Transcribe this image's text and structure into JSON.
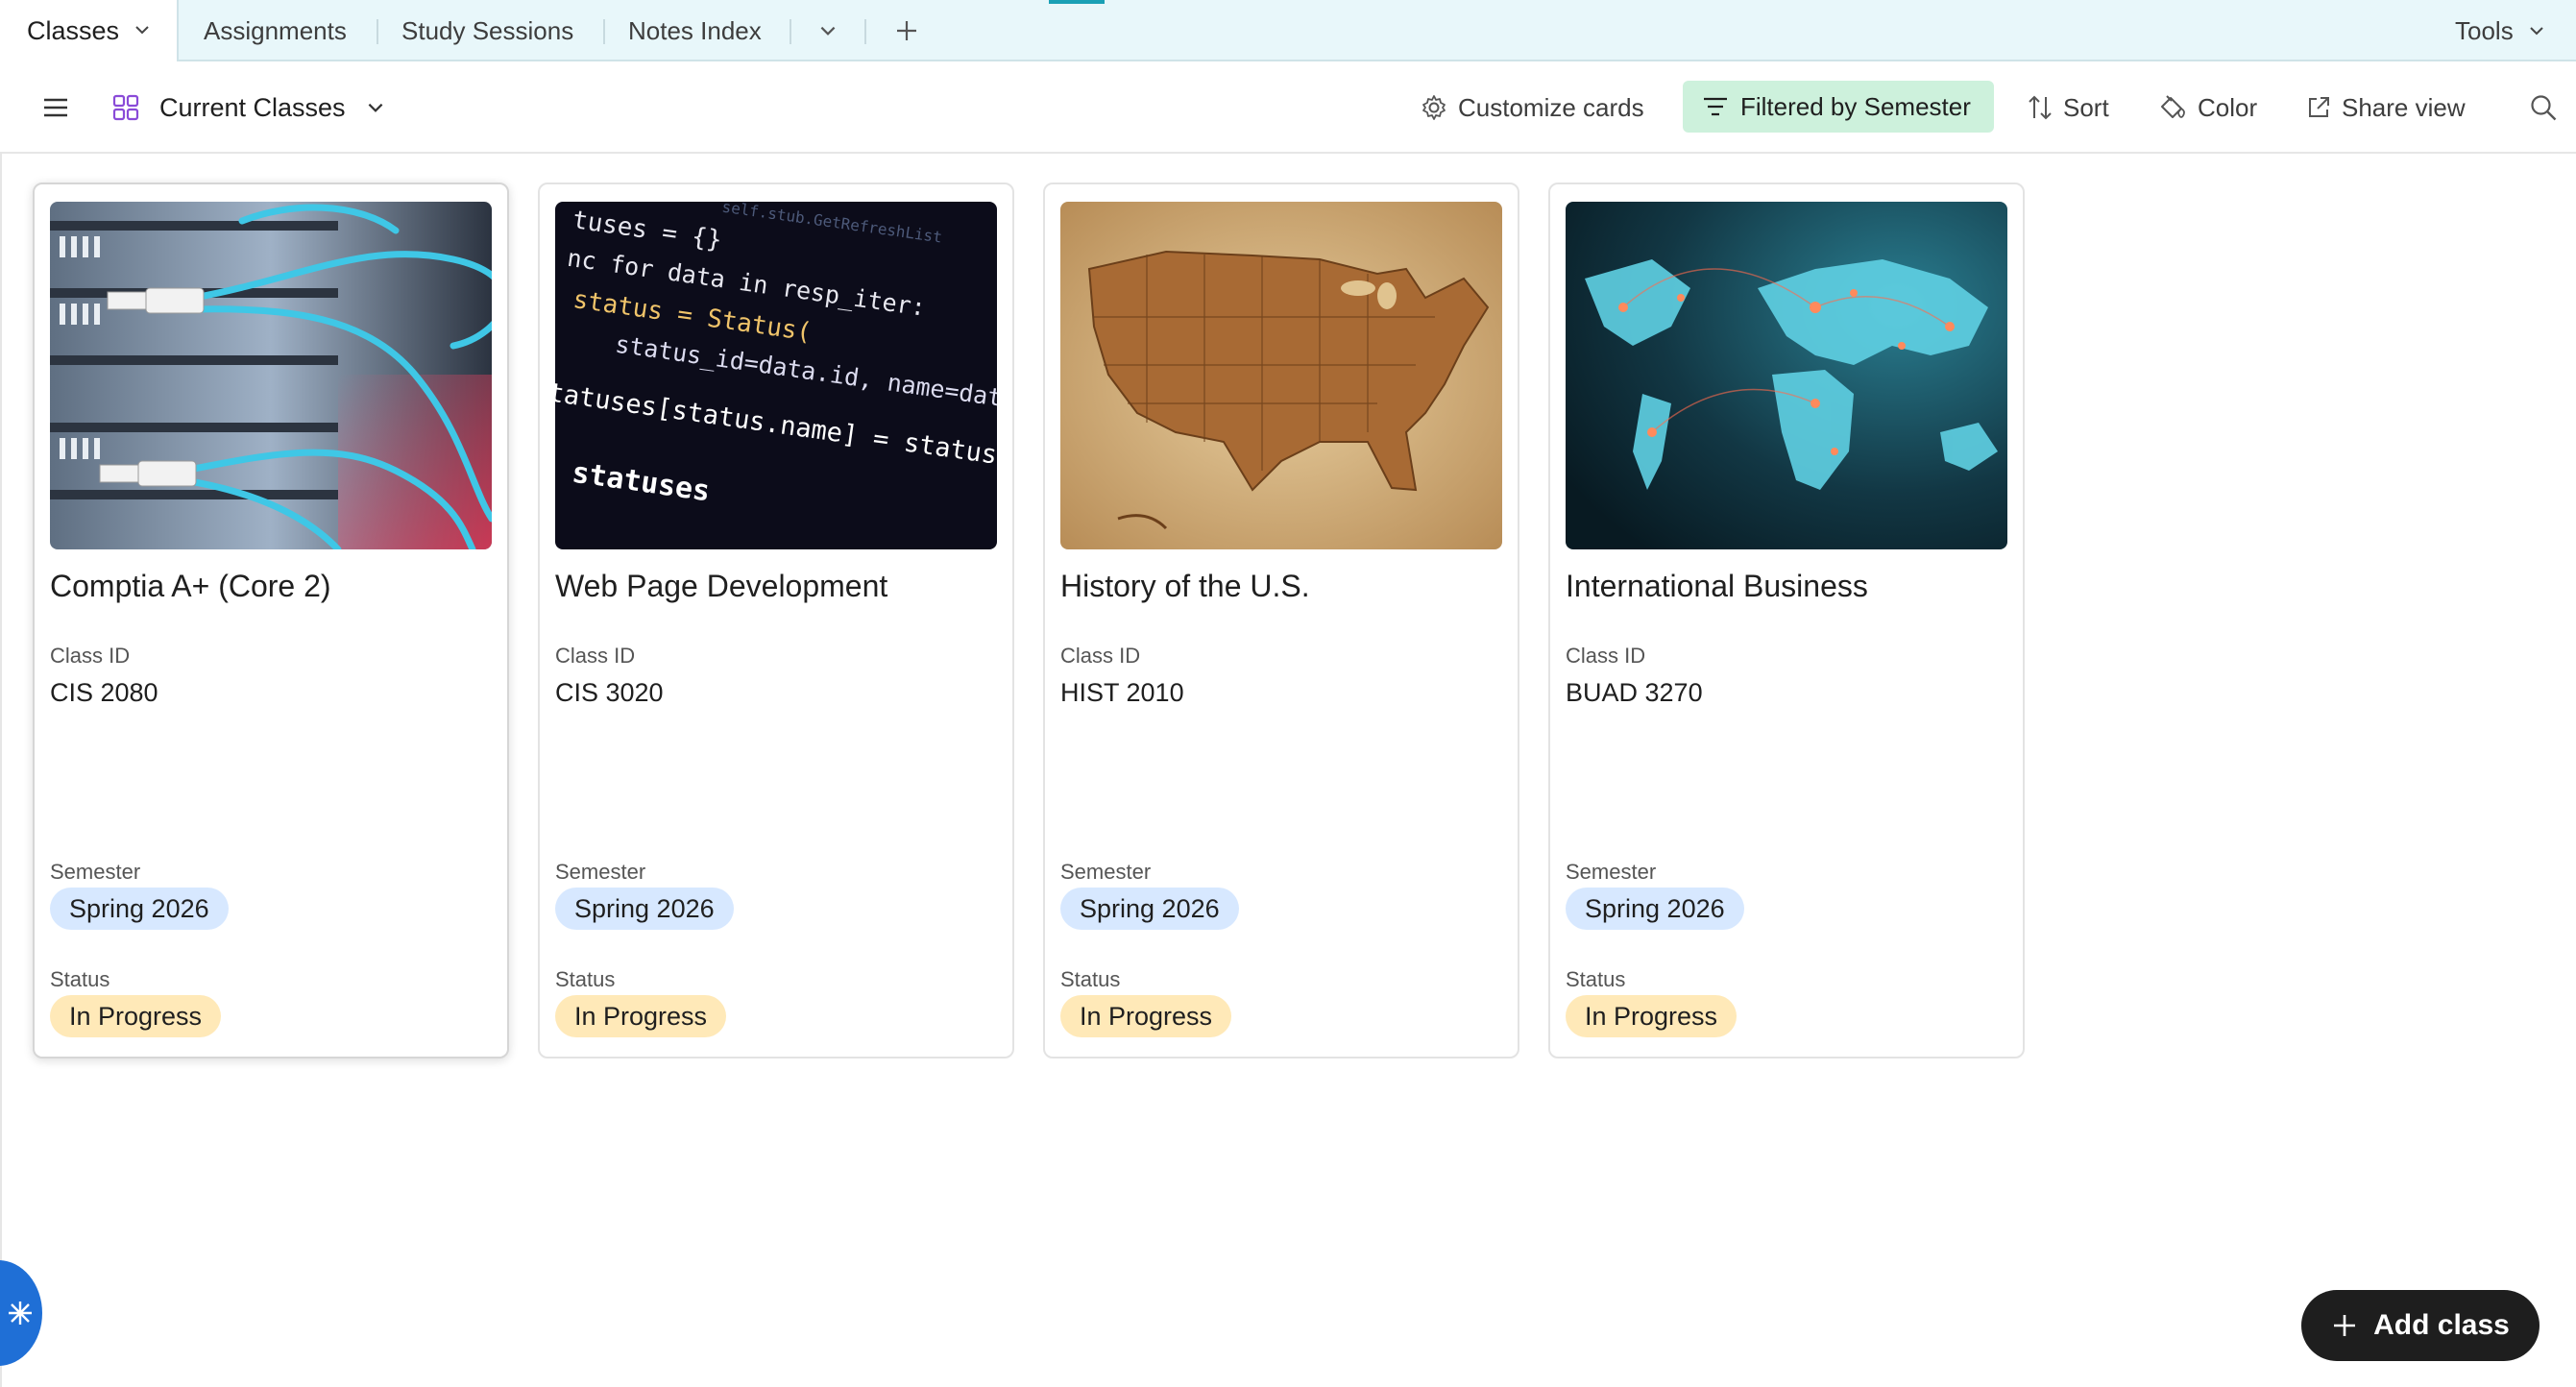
{
  "tabs": {
    "active": "Classes",
    "items": [
      "Assignments",
      "Study Sessions",
      "Notes Index"
    ],
    "tools_label": "Tools"
  },
  "view": {
    "name": "Current Classes",
    "actions": {
      "customize": "Customize cards",
      "filter": "Filtered by Semester",
      "sort": "Sort",
      "color": "Color",
      "share": "Share view"
    }
  },
  "fields": {
    "class_id": "Class ID",
    "semester": "Semester",
    "status": "Status"
  },
  "cards": [
    {
      "title": "Comptia A+ (Core 2)",
      "class_id": "CIS 2080",
      "semester": "Spring 2026",
      "status": "In Progress",
      "cover": "server-network-cables"
    },
    {
      "title": "Web Page Development",
      "class_id": "CIS 3020",
      "semester": "Spring 2026",
      "status": "In Progress",
      "cover": "code-editor"
    },
    {
      "title": "History of the U.S.",
      "class_id": "HIST 2010",
      "semester": "Spring 2026",
      "status": "In Progress",
      "cover": "us-map-parchment"
    },
    {
      "title": "International Business",
      "class_id": "BUAD 3270",
      "semester": "Spring 2026",
      "status": "In Progress",
      "cover": "world-map-network"
    }
  ],
  "code_cover": {
    "line1": "tuses = {}",
    "line2": "nc for data in resp_iter:",
    "line3": "status = Status(",
    "line4": "status_id=data.id, name=data.",
    "line5": "tatuses[status.name] = status",
    "line6": "n statuses",
    "line0": "self.stub.GetRefreshList"
  },
  "add_button": "Add class",
  "colors": {
    "tabbar_bg": "#e8f7fa",
    "filter_bg": "#cdf1dc",
    "semester_chip": "#d7e8ff",
    "status_chip": "#ffe9b8",
    "add_button_bg": "#1e1e1e",
    "fab_bg": "#1f6fd6"
  }
}
